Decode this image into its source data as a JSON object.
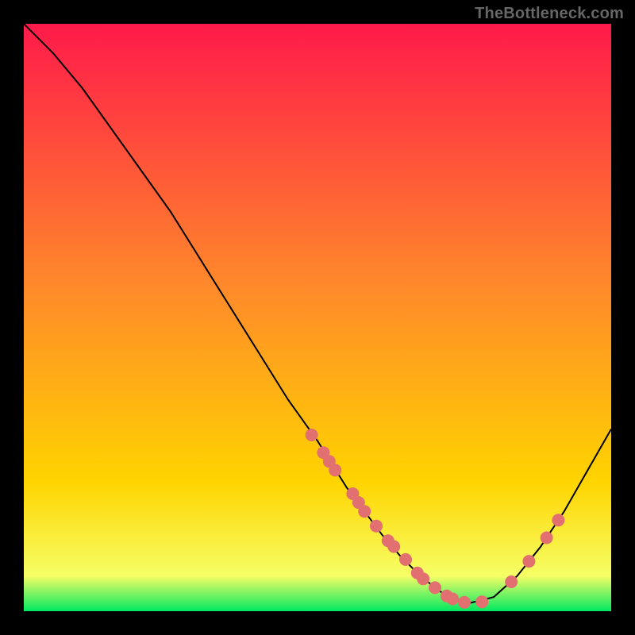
{
  "watermark": "TheBottleneck.com",
  "colors": {
    "background": "#000000",
    "gradient_top": "#ff1a4a",
    "gradient_mid": "#ffd400",
    "gradient_low": "#f6ff66",
    "gradient_bottom": "#00e860",
    "curve": "#000000",
    "dot": "#e27070"
  },
  "chart_data": {
    "type": "line",
    "title": "",
    "xlabel": "",
    "ylabel": "",
    "xlim": [
      0,
      100
    ],
    "ylim": [
      0,
      100
    ],
    "grid": false,
    "legend": false,
    "series": [
      {
        "name": "bottleneck-curve",
        "x": [
          0,
          5,
          10,
          15,
          20,
          25,
          30,
          35,
          40,
          45,
          50,
          55,
          58,
          61,
          64,
          67,
          70,
          72,
          74,
          76,
          80,
          84,
          88,
          92,
          96,
          100
        ],
        "y": [
          100,
          95,
          89,
          82,
          75,
          68,
          60,
          52,
          44,
          36,
          29,
          21,
          17,
          13,
          9.5,
          6.5,
          4,
          2.6,
          1.8,
          1.4,
          2.4,
          6,
          11,
          17,
          24,
          31
        ]
      }
    ],
    "scatter_overlay": {
      "name": "sample-points",
      "x": [
        49,
        51,
        52,
        53,
        56,
        57,
        58,
        60,
        62,
        63,
        65,
        67,
        68,
        70,
        72,
        73,
        75,
        78,
        83,
        86,
        89,
        91
      ],
      "y": [
        30,
        27,
        25.5,
        24,
        20,
        18.5,
        17,
        14.5,
        12,
        11,
        8.8,
        6.5,
        5.5,
        4,
        2.6,
        2.1,
        1.5,
        1.6,
        5.0,
        8.5,
        12.5,
        15.5
      ]
    }
  }
}
